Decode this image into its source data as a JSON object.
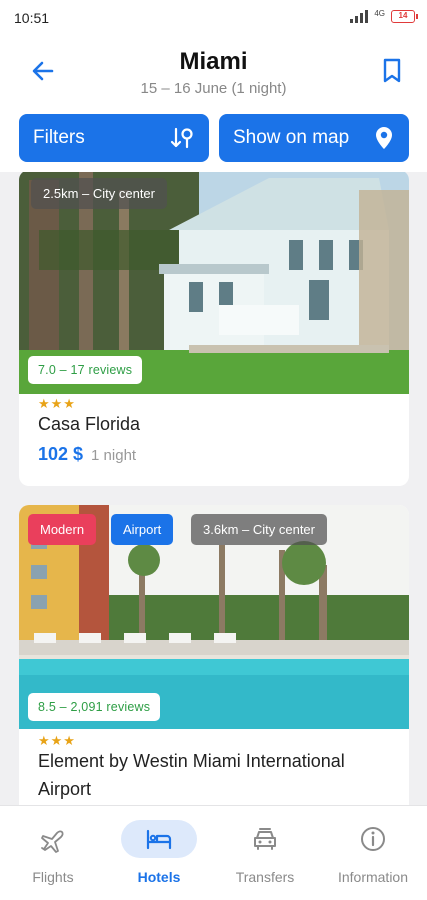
{
  "status_bar": {
    "time": "10:51",
    "network": "4G",
    "battery": "14"
  },
  "header": {
    "title": "Miami",
    "subtitle": "15 – 16 June (1 night)"
  },
  "actions": {
    "filters_label": "Filters",
    "map_label": "Show on map"
  },
  "hotels": [
    {
      "distance": "2.5km – City center",
      "rating": "7.0 – 17 reviews",
      "stars": "★★★",
      "name": "Casa Florida",
      "price": "102 $",
      "nights": "1 night"
    },
    {
      "tags": [
        "Modern",
        "Airport"
      ],
      "distance": "3.6km – City center",
      "rating": "8.5 – 2,091 reviews",
      "stars": "★★★",
      "name": "Element by Westin Miami International Airport"
    }
  ],
  "nav": {
    "items": [
      {
        "label": "Flights",
        "icon": "airplane-icon"
      },
      {
        "label": "Hotels",
        "icon": "bed-icon",
        "active": true
      },
      {
        "label": "Transfers",
        "icon": "car-icon"
      },
      {
        "label": "Information",
        "icon": "info-icon"
      }
    ]
  },
  "colors": {
    "accent": "#1b73e8",
    "rating_green": "#2e9e45",
    "tag_red": "#ea3f5c",
    "star": "#e8a317"
  }
}
